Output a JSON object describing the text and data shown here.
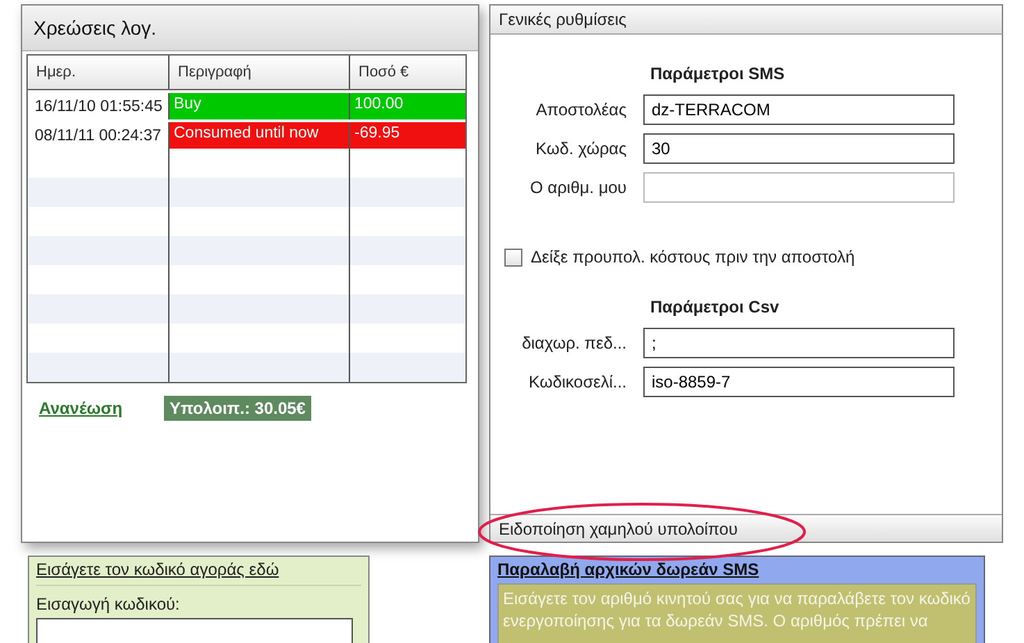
{
  "charges_panel": {
    "title": "Χρεώσεις λογ.",
    "table": {
      "columns": [
        "Ημερ.",
        "Περιγραφή",
        "Ποσό €"
      ],
      "rows": [
        {
          "date": "16/11/10 01:55:45",
          "description": "Buy",
          "amount": "100.00",
          "color": "#00c800"
        },
        {
          "date": "08/11/11 00:24:37",
          "description": "Consumed until now",
          "amount": "-69.95",
          "color": "#f01010"
        }
      ]
    },
    "refresh_link": "Ανανέωση",
    "balance": "Υπολοιπ.: 30.05€"
  },
  "purchase_code_box": {
    "title": "Εισάγετε τον κωδικό αγοράς εδώ",
    "label": "Εισαγωγή κωδικού:"
  },
  "settings_panel": {
    "title": "Γενικές ρυθμίσεις",
    "sms_section": {
      "heading": "Παράμετροι SMS",
      "fields": [
        {
          "label": "Αποστολέας",
          "value": "dz-TERRACOM",
          "disabled": false
        },
        {
          "label": "Κωδ. χώρας",
          "value": "30",
          "disabled": false
        },
        {
          "label": "Ο αριθμ. μου",
          "disabled": true
        }
      ]
    },
    "cost_checkbox": {
      "label": "Δείξε προυπολ. κόστους πριν την αποστολή",
      "checked": false
    },
    "csv_section": {
      "heading": "Παράμετροι Csv",
      "fields": [
        {
          "label": "διαχωρ. πεδ...",
          "value": ";",
          "disabled": false
        },
        {
          "label": "Κωδικοσελί...",
          "value": "iso-8859-7",
          "disabled": false
        }
      ]
    },
    "low_balance_header": "Ειδοποίηση χαμηλού υπολοίπου",
    "low_balance_highlighted": true
  },
  "free_sms_box": {
    "title": "Παραλαβή αρχικών δωρεάν SMS",
    "text": "Εισάγετε τον αριθμό κινητού σας για να παραλάβετε τον κωδικό ενεργοποίησης για τα δωρεάν SMS. Ο αριθμός πρέπει να"
  }
}
